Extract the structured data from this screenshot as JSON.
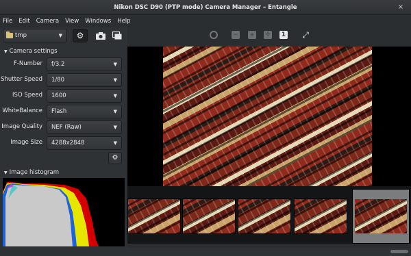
{
  "window": {
    "title": "Nikon DSC D90 (PTP mode) Camera Manager – Entangle",
    "close": "×"
  },
  "menu": [
    "File",
    "Edit",
    "Camera",
    "View",
    "Windows",
    "Help"
  ],
  "toolbar": {
    "folder": "tmp"
  },
  "camera_settings": {
    "header": "Camera settings",
    "rows": [
      {
        "label": "F-Number",
        "value": "f/3.2"
      },
      {
        "label": "Shutter Speed",
        "value": "1/80"
      },
      {
        "label": "ISO Speed",
        "value": "1600"
      },
      {
        "label": "WhiteBalance",
        "value": "Flash"
      },
      {
        "label": "Image Quality",
        "value": "NEF (Raw)"
      },
      {
        "label": "Image Size",
        "value": "4288x2848"
      }
    ]
  },
  "histogram": {
    "header": "Image histogram"
  },
  "viewer_toolbar": {
    "fit_label": "1"
  },
  "thumbnails": {
    "count": 5,
    "selected_index": 4
  },
  "colors": {
    "accent": "#e6e6e6",
    "panel": "#2f3234",
    "hist_red": "#d40000",
    "hist_yellow": "#e6e600",
    "hist_blue": "#1e64d8"
  }
}
